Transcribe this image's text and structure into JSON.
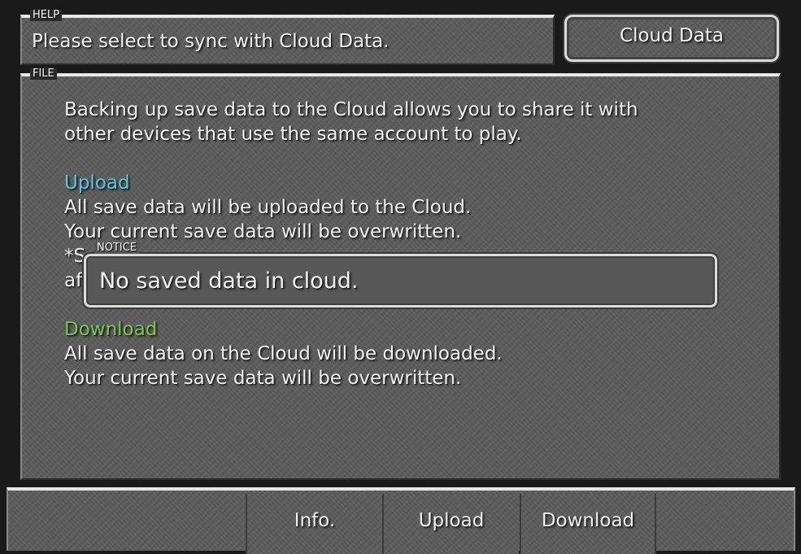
{
  "help": {
    "tag": "HELP",
    "text": "Please select to sync with Cloud Data."
  },
  "cloud_button": {
    "label": "Cloud Data"
  },
  "file": {
    "tag": "FILE",
    "intro_line1": "Backing up save data to the Cloud allows you to share it with",
    "intro_line2": "other devices that use the same account to play.",
    "upload_heading": "Upload",
    "upload_line1": "All save data will be uploaded to the Cloud.",
    "upload_line2": "Your current save data will be overwritten.",
    "upload_line3_visible_start": "*S",
    "upload_line4_visible_start": "af",
    "download_heading": "Download",
    "download_line1": "All save data on the Cloud will be downloaded.",
    "download_line2": "Your current save data will be overwritten."
  },
  "notice": {
    "tag": "NOTICE",
    "text": "No saved data in cloud."
  },
  "menu": {
    "items": [
      {
        "label": "Info."
      },
      {
        "label": "Upload"
      },
      {
        "label": "Download"
      }
    ]
  },
  "colors": {
    "upload_heading": "#58c8e0",
    "download_heading": "#78c850",
    "panel": "#5c5c5c"
  }
}
